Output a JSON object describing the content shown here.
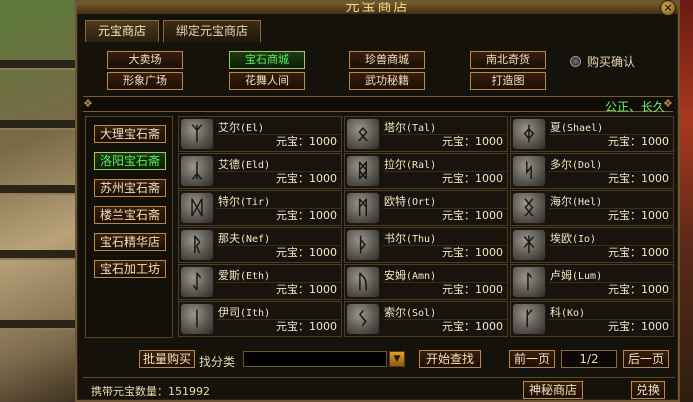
{
  "window": {
    "title": "元宝商店",
    "close_label": "×"
  },
  "tabs": [
    {
      "label": "元宝商店"
    },
    {
      "label": "绑定元宝商店"
    }
  ],
  "categories": [
    {
      "label": "大卖场"
    },
    {
      "label": "宝石商城"
    },
    {
      "label": "珍兽商城"
    },
    {
      "label": "南北奇货"
    },
    {
      "label": "形象广场"
    },
    {
      "label": "花舞人间"
    },
    {
      "label": "武功秘籍"
    },
    {
      "label": "打造图"
    }
  ],
  "confirm_label": "购买确认",
  "marquee": "公正、长久",
  "stores": [
    {
      "label": "大理宝石斋"
    },
    {
      "label": "洛阳宝石斋"
    },
    {
      "label": "苏州宝石斋"
    },
    {
      "label": "楼兰宝石斋"
    },
    {
      "label": "宝石精华店"
    },
    {
      "label": "宝石加工坊"
    }
  ],
  "items": [
    {
      "name": "艾尔",
      "code": "(El)",
      "price_label": "元宝：",
      "price": "1000",
      "rune": "ᛉ"
    },
    {
      "name": "塔尔",
      "code": "(Tal)",
      "price_label": "元宝：",
      "price": "1000",
      "rune": "ᛟ"
    },
    {
      "name": "夏",
      "code": "(Shael)",
      "price_label": "元宝：",
      "price": "1000",
      "rune": "ᛄ"
    },
    {
      "name": "艾德",
      "code": "(Eld)",
      "price_label": "元宝：",
      "price": "1000",
      "rune": "ᛣ"
    },
    {
      "name": "拉尔",
      "code": "(Ral)",
      "price_label": "元宝：",
      "price": "1000",
      "rune": "ᛥ"
    },
    {
      "name": "多尔",
      "code": "(Dol)",
      "price_label": "元宝：",
      "price": "1000",
      "rune": "ᛋ"
    },
    {
      "name": "特尔",
      "code": "(Tir)",
      "price_label": "元宝：",
      "price": "1000",
      "rune": "ᛞ"
    },
    {
      "name": "欧特",
      "code": "(Ort)",
      "price_label": "元宝：",
      "price": "1000",
      "rune": "ᛗ"
    },
    {
      "name": "海尔",
      "code": "(Hel)",
      "price_label": "元宝：",
      "price": "1000",
      "rune": "ᛝ"
    },
    {
      "name": "那夫",
      "code": "(Nef)",
      "price_label": "元宝：",
      "price": "1000",
      "rune": "ᚱ"
    },
    {
      "name": "书尔",
      "code": "(Thu)",
      "price_label": "元宝：",
      "price": "1000",
      "rune": "ᚦ"
    },
    {
      "name": "埃欧",
      "code": "(Io)",
      "price_label": "元宝：",
      "price": "1000",
      "rune": "ᛡ"
    },
    {
      "name": "爱斯",
      "code": "(Eth)",
      "price_label": "元宝：",
      "price": "1000",
      "rune": "ᛇ"
    },
    {
      "name": "安姆",
      "code": "(Amn)",
      "price_label": "元宝：",
      "price": "1000",
      "rune": "ᚢ"
    },
    {
      "name": "卢姆",
      "code": "(Lum)",
      "price_label": "元宝：",
      "price": "1000",
      "rune": "ᛚ"
    },
    {
      "name": "伊司",
      "code": "(Ith)",
      "price_label": "元宝：",
      "price": "1000",
      "rune": "ᛁ"
    },
    {
      "name": "索尔",
      "code": "(Sol)",
      "price_label": "元宝：",
      "price": "1000",
      "rune": "ᛊ"
    },
    {
      "name": "科",
      "code": "(Ko)",
      "price_label": "元宝：",
      "price": "1000",
      "rune": "ᚴ"
    }
  ],
  "bottom": {
    "bulk_buy": "批量购买",
    "search_label": "找分类",
    "search_value": "",
    "dropdown_icon": "▼",
    "search_button": "开始查找",
    "prev_page": "前一页",
    "page_indicator": "1/2",
    "next_page": "后一页"
  },
  "status": {
    "carry_label": "携带元宝数量：",
    "carry_value": "151992",
    "mystery_shop": "神秘商店",
    "exchange": "兑换"
  }
}
